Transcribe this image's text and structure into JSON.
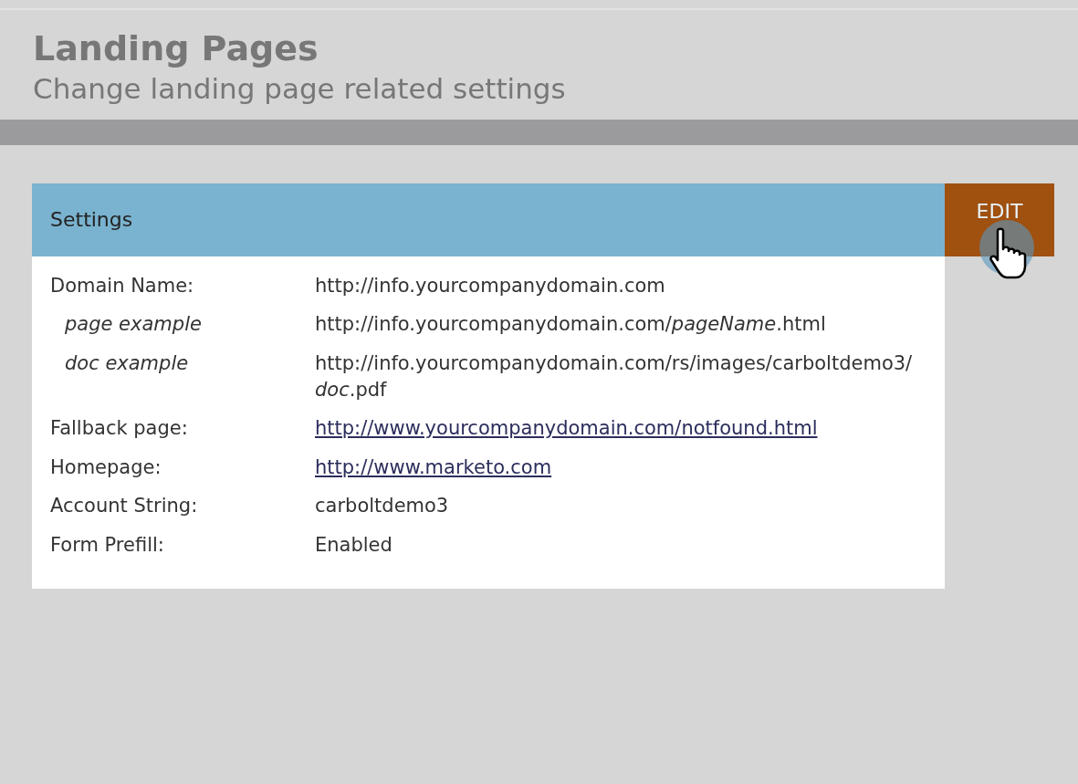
{
  "header": {
    "title": "Landing Pages",
    "subtitle": "Change landing page related settings"
  },
  "panel": {
    "title": "Settings",
    "button": "EDIT",
    "button_hover": true,
    "rows": [
      {
        "kind": "plain",
        "label": "Domain Name:",
        "value": "http://info.yourcompanydomain.com"
      },
      {
        "kind": "example",
        "label": "page example",
        "value": "http://info.yourcompanydomain.com/*pageName*.html"
      },
      {
        "kind": "example",
        "label": "doc example",
        "value": "http://info.yourcompanydomain.com/rs/images/carboltdemo3/*doc*.pdf"
      },
      {
        "kind": "link",
        "label": "Fallback page:",
        "value": "http://www.yourcompanydomain.com/notfound.html"
      },
      {
        "kind": "link",
        "label": "Homepage:",
        "value": "http://www.marketo.com"
      },
      {
        "kind": "plain",
        "label": "Account String:",
        "value": "carboltdemo3"
      },
      {
        "kind": "plain",
        "label": "Form Prefill:",
        "value": "Enabled"
      }
    ]
  }
}
